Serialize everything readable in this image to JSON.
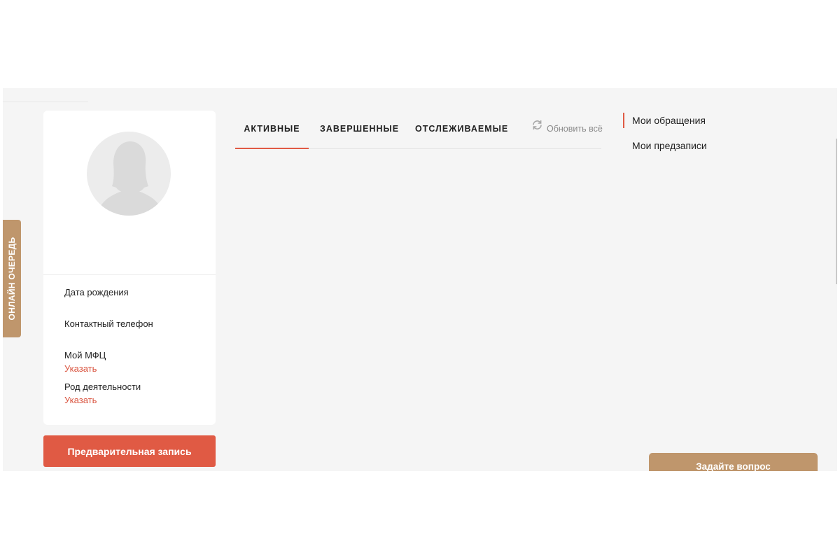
{
  "sidebar": {
    "online_queue_label": "ОНЛАЙН ОЧЕРЕДЬ"
  },
  "profile": {
    "avatar_icon": "user-silhouette-icon",
    "fields": [
      {
        "label": "Дата рождения",
        "action": ""
      },
      {
        "label": "Контактный телефон",
        "action": ""
      },
      {
        "label": "Мой МФЦ",
        "action": "Указать"
      },
      {
        "label": "Род деятельности",
        "action": "Указать"
      }
    ],
    "pre_registration_button": "Предварительная запись"
  },
  "tabs": {
    "items": [
      {
        "label": "АКТИВНЫЕ",
        "active": true
      },
      {
        "label": "ЗАВЕРШЕННЫЕ",
        "active": false
      },
      {
        "label": "ОТСЛЕЖИВАЕМЫЕ",
        "active": false
      }
    ],
    "refresh_label": "Обновить всё",
    "refresh_icon": "refresh-icon"
  },
  "right_nav": {
    "items": [
      {
        "label": "Мои обращения",
        "active": true
      },
      {
        "label": "Мои предзаписи",
        "active": false
      }
    ]
  },
  "ask_button": "Задайте вопрос",
  "colors": {
    "accent": "#e05a44",
    "brand_tan": "#bf966c",
    "background": "#f5f5f5"
  }
}
